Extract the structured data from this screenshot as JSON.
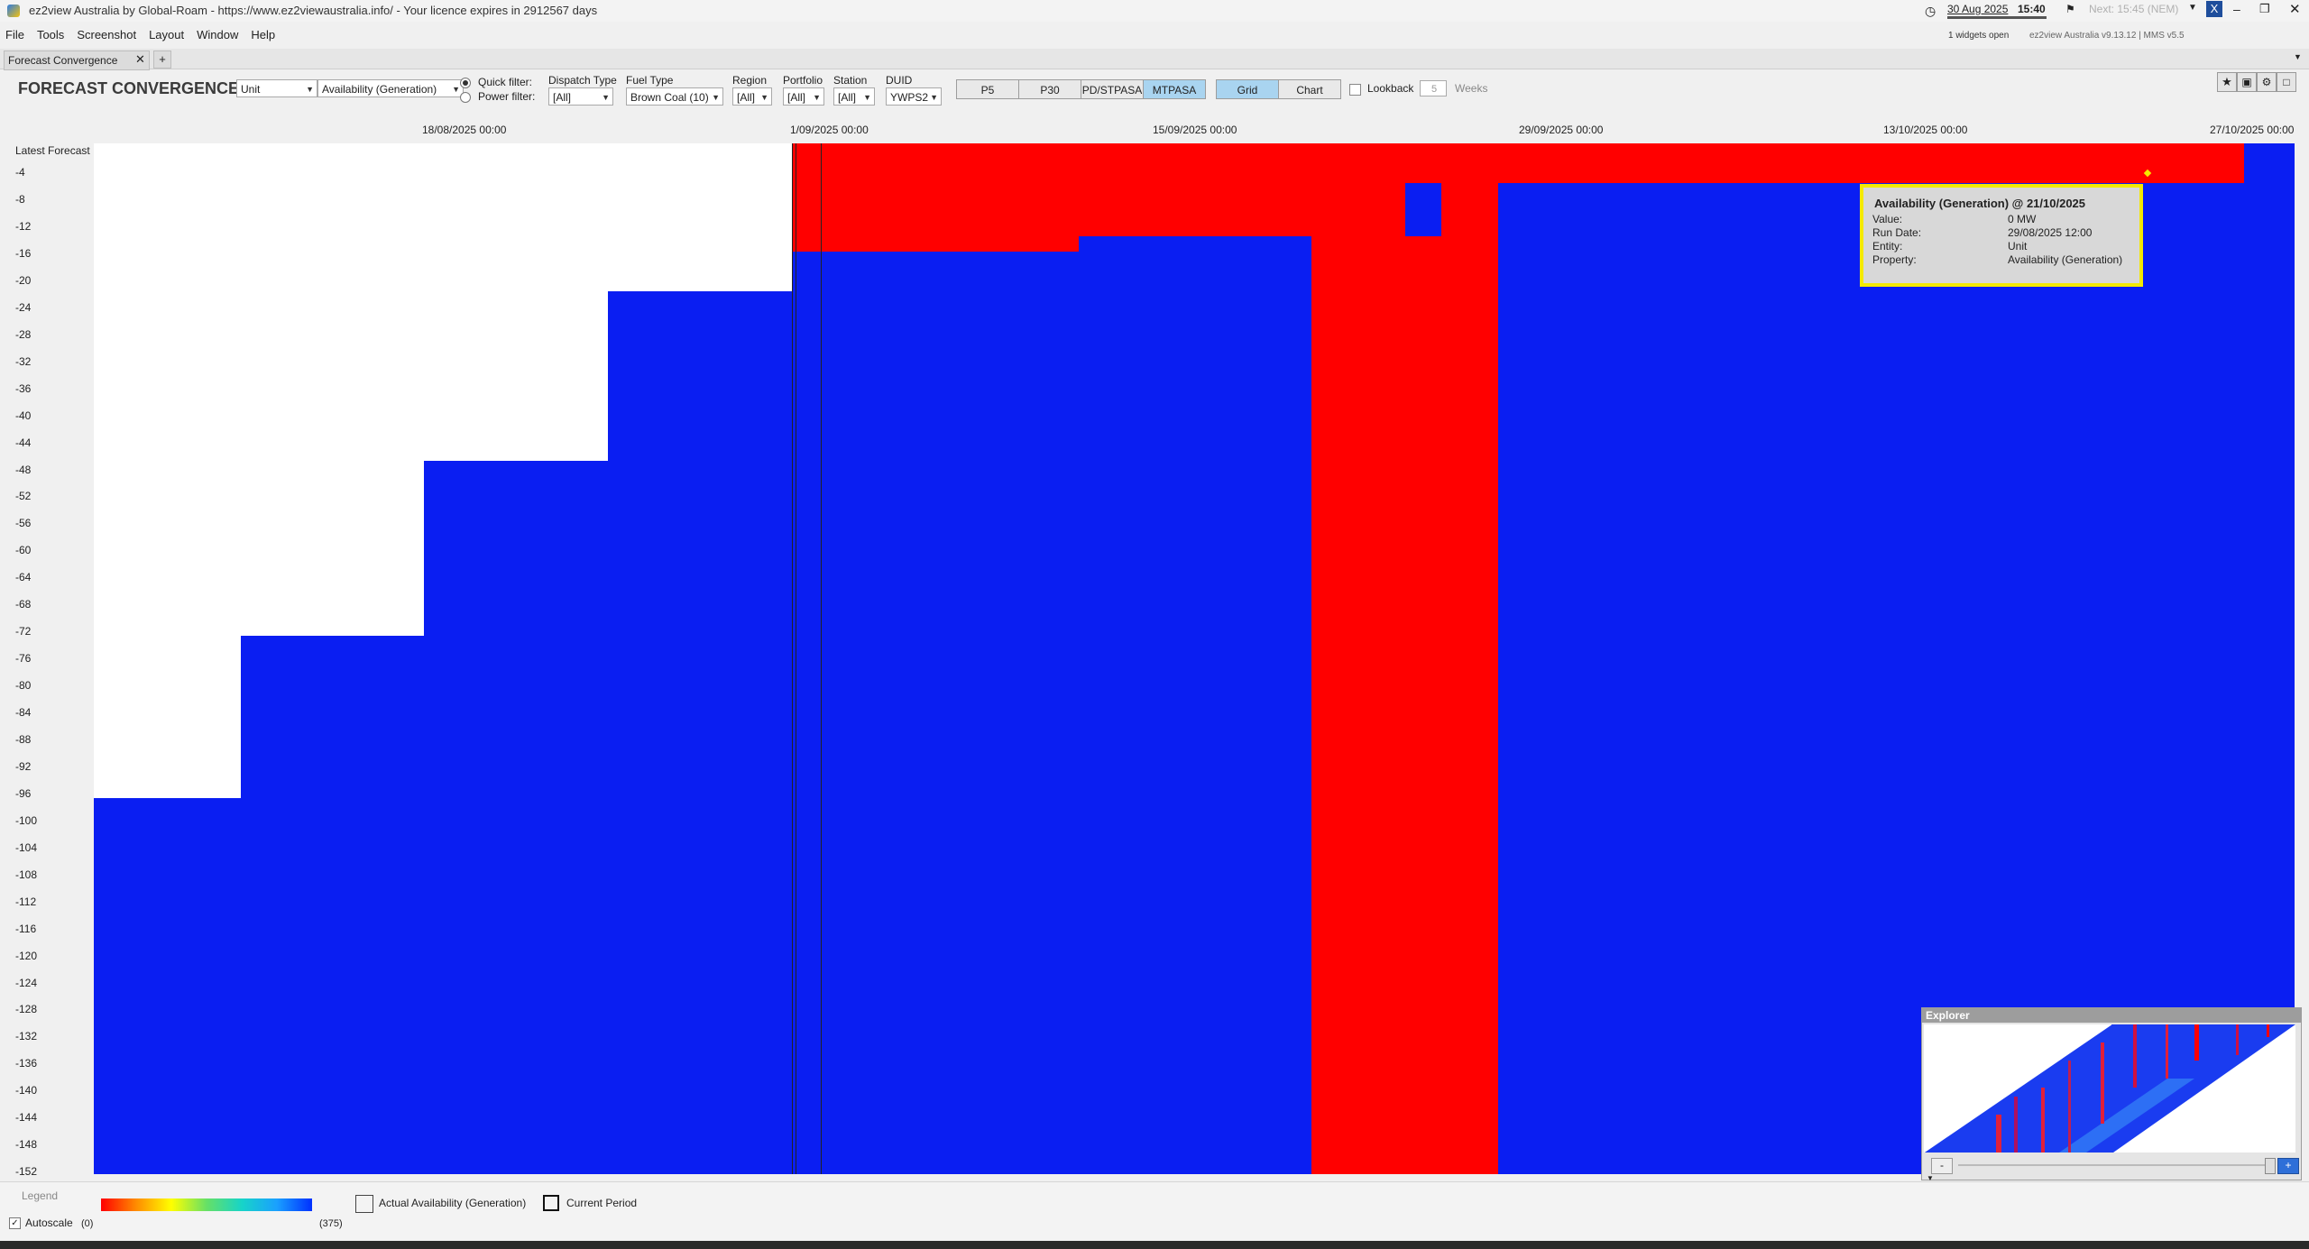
{
  "window": {
    "title": "ez2view Australia by Global-Roam - https://www.ez2viewaustralia.info/ - Your licence expires in 2912567 days",
    "date": "30 Aug 2025",
    "time": "15:40",
    "next": "Next: 15:45 (NEM)",
    "widgets_open": "1 widgets open",
    "version": "ez2view Australia v9.13.12 | MMS v5.5"
  },
  "menu": [
    "File",
    "Tools",
    "Screenshot",
    "Layout",
    "Window",
    "Help"
  ],
  "tabs": {
    "active": "Forecast Convergence",
    "add": "+"
  },
  "toolbar": {
    "title": "FORECAST CONVERGENCE",
    "unit": "Unit",
    "property": "Availability (Generation)",
    "quick_filter": "Quick filter:",
    "power_filter": "Power filter:",
    "dispatch_type_label": "Dispatch Type",
    "dispatch_type": "[All]",
    "fuel_type_label": "Fuel Type",
    "fuel_type": "Brown Coal (10)",
    "region_label": "Region",
    "region": "[All]",
    "portfolio_label": "Portfolio",
    "portfolio": "[All]",
    "station_label": "Station",
    "station": "[All]",
    "duid_label": "DUID",
    "duid": "YWPS2",
    "views": [
      "P5",
      "P30",
      "PD/STPASA",
      "MTPASA"
    ],
    "modes": [
      "Grid",
      "Chart"
    ],
    "lookback_label": "Lookback",
    "lookback_value": "5",
    "weeks_label": "Weeks"
  },
  "grid": {
    "x_labels": [
      "18/08/2025 00:00",
      "1/09/2025 00:00",
      "15/09/2025 00:00",
      "29/09/2025 00:00",
      "13/10/2025 00:00",
      "27/10/2025 00:00"
    ],
    "y_first": "Latest Forecast",
    "y_labels": [
      "-4",
      "-8",
      "-12",
      "-16",
      "-20",
      "-24",
      "-28",
      "-32",
      "-36",
      "-40",
      "-44",
      "-48",
      "-52",
      "-56",
      "-60",
      "-64",
      "-68",
      "-72",
      "-76",
      "-80",
      "-84",
      "-88",
      "-92",
      "-96",
      "-100",
      "-104",
      "-108",
      "-112",
      "-116",
      "-120",
      "-124",
      "-128",
      "-132",
      "-136",
      "-140",
      "-144",
      "-148",
      "-152"
    ]
  },
  "tooltip": {
    "title": "Availability (Generation) @ 21/10/2025",
    "rows": [
      {
        "k": "Value:",
        "v": "0 MW"
      },
      {
        "k": "Run Date:",
        "v": "29/08/2025 12:00"
      },
      {
        "k": "Entity:",
        "v": "Unit"
      },
      {
        "k": "Property:",
        "v": "Availability (Generation)"
      }
    ]
  },
  "explorer": {
    "title": "Explorer",
    "minus": "-",
    "plus": "+"
  },
  "legend": {
    "title": "Legend",
    "autoscale": "Autoscale",
    "min": "(0)",
    "max": "(375)",
    "actual": "Actual Availability (Generation)",
    "current": "Current Period"
  },
  "colors": {
    "red": "#ff0000",
    "blue": "#0a1ef2",
    "white": "#ffffff"
  }
}
